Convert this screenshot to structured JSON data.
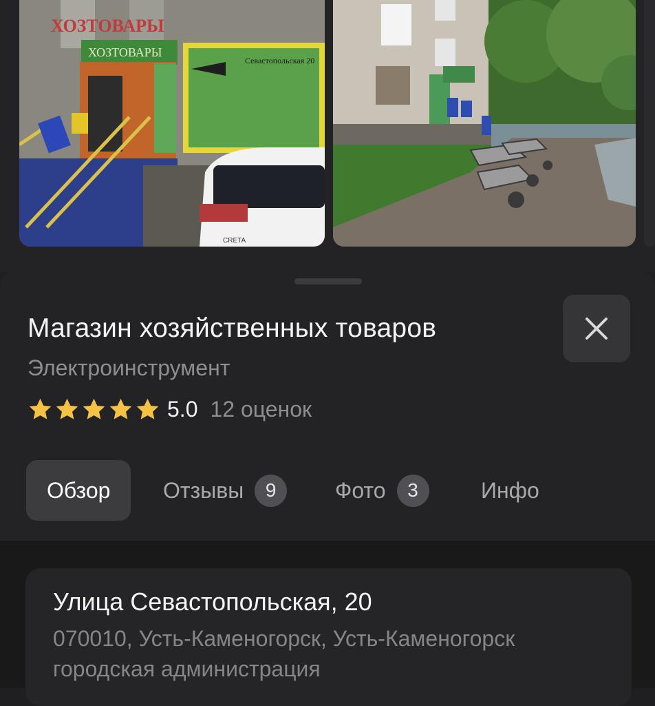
{
  "gallery": {
    "photos": [
      {
        "name": "storefront-photo",
        "sign_text": "ХОЗТОВАРЫ",
        "sign_address": "Севастопольская 20",
        "car_model": "CRETA"
      },
      {
        "name": "building-photo"
      }
    ]
  },
  "place": {
    "title": "Магазин хозяйственных товаров",
    "category": "Электроинструмент",
    "rating_value": "5.0",
    "rating_stars": 5,
    "rating_count_label": "12 оценок",
    "star_color": "#f6c244"
  },
  "tabs": [
    {
      "label": "Обзор",
      "active": true
    },
    {
      "label": "Отзывы",
      "badge": "9"
    },
    {
      "label": "Фото",
      "badge": "3"
    },
    {
      "label": "Инфо"
    }
  ],
  "address": {
    "street": "Улица Севастопольская, 20",
    "city": "070010, Усть-Каменогорск, Усть-Каменогорск городская администрация"
  },
  "icons": {
    "close": "close-icon",
    "star": "star-icon"
  }
}
